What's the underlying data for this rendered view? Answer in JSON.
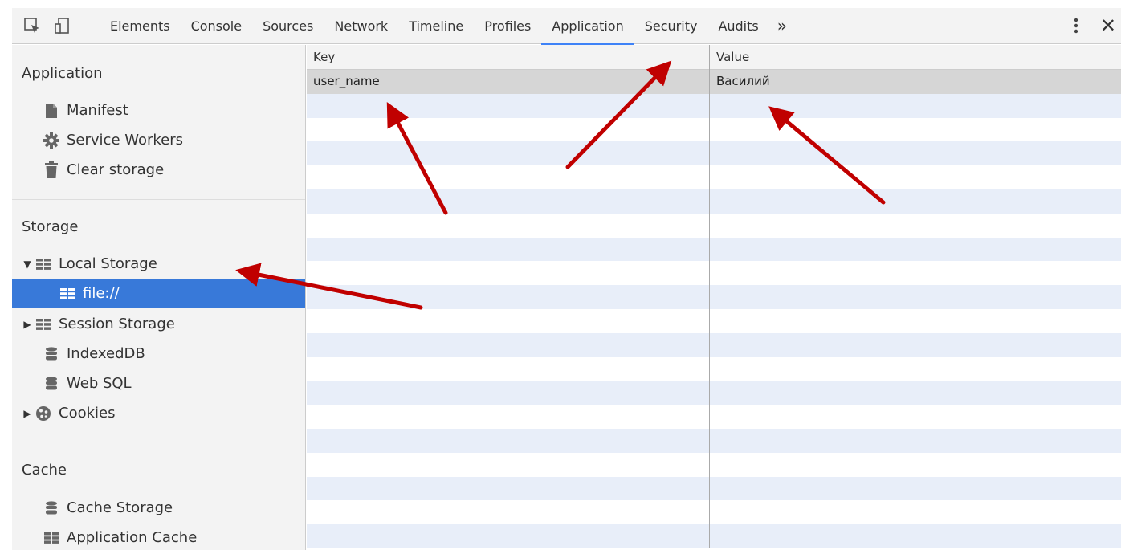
{
  "toolbar": {
    "tabs": [
      {
        "label": "Elements"
      },
      {
        "label": "Console"
      },
      {
        "label": "Sources"
      },
      {
        "label": "Network"
      },
      {
        "label": "Timeline"
      },
      {
        "label": "Profiles"
      },
      {
        "label": "Application",
        "active": true
      },
      {
        "label": "Security"
      },
      {
        "label": "Audits"
      }
    ],
    "more_label": "»",
    "close_label": "✕",
    "icons": [
      "inspect-element-icon",
      "device-toolbar-icon",
      "more-tabs-icon",
      "kebab-menu-icon",
      "close-icon"
    ]
  },
  "sidebar": {
    "application": {
      "title": "Application",
      "items": [
        {
          "label": "Manifest",
          "icon": "file-icon"
        },
        {
          "label": "Service Workers",
          "icon": "gear-icon"
        },
        {
          "label": "Clear storage",
          "icon": "trash-icon"
        }
      ]
    },
    "storage": {
      "title": "Storage",
      "items": [
        {
          "label": "Local Storage",
          "icon": "grid-icon",
          "expand": "expanded"
        },
        {
          "label": "file://",
          "icon": "grid-icon",
          "selected": true
        },
        {
          "label": "Session Storage",
          "icon": "grid-icon",
          "expand": "collapsed"
        },
        {
          "label": "IndexedDB",
          "icon": "database-icon"
        },
        {
          "label": "Web SQL",
          "icon": "database-icon"
        },
        {
          "label": "Cookies",
          "icon": "cookie-icon",
          "expand": "collapsed"
        }
      ]
    },
    "cache": {
      "title": "Cache",
      "items": [
        {
          "label": "Cache Storage",
          "icon": "database-icon"
        },
        {
          "label": "Application Cache",
          "icon": "grid-icon"
        }
      ]
    }
  },
  "table": {
    "columns": [
      "Key",
      "Value"
    ],
    "rows": [
      {
        "key": "user_name",
        "value": "Василий",
        "selected": true
      }
    ]
  },
  "colors": {
    "active_tab": "#3e82f7",
    "selected_item": "#3879d9",
    "stripe": "#e8eef9",
    "arrow": "#c00000"
  }
}
